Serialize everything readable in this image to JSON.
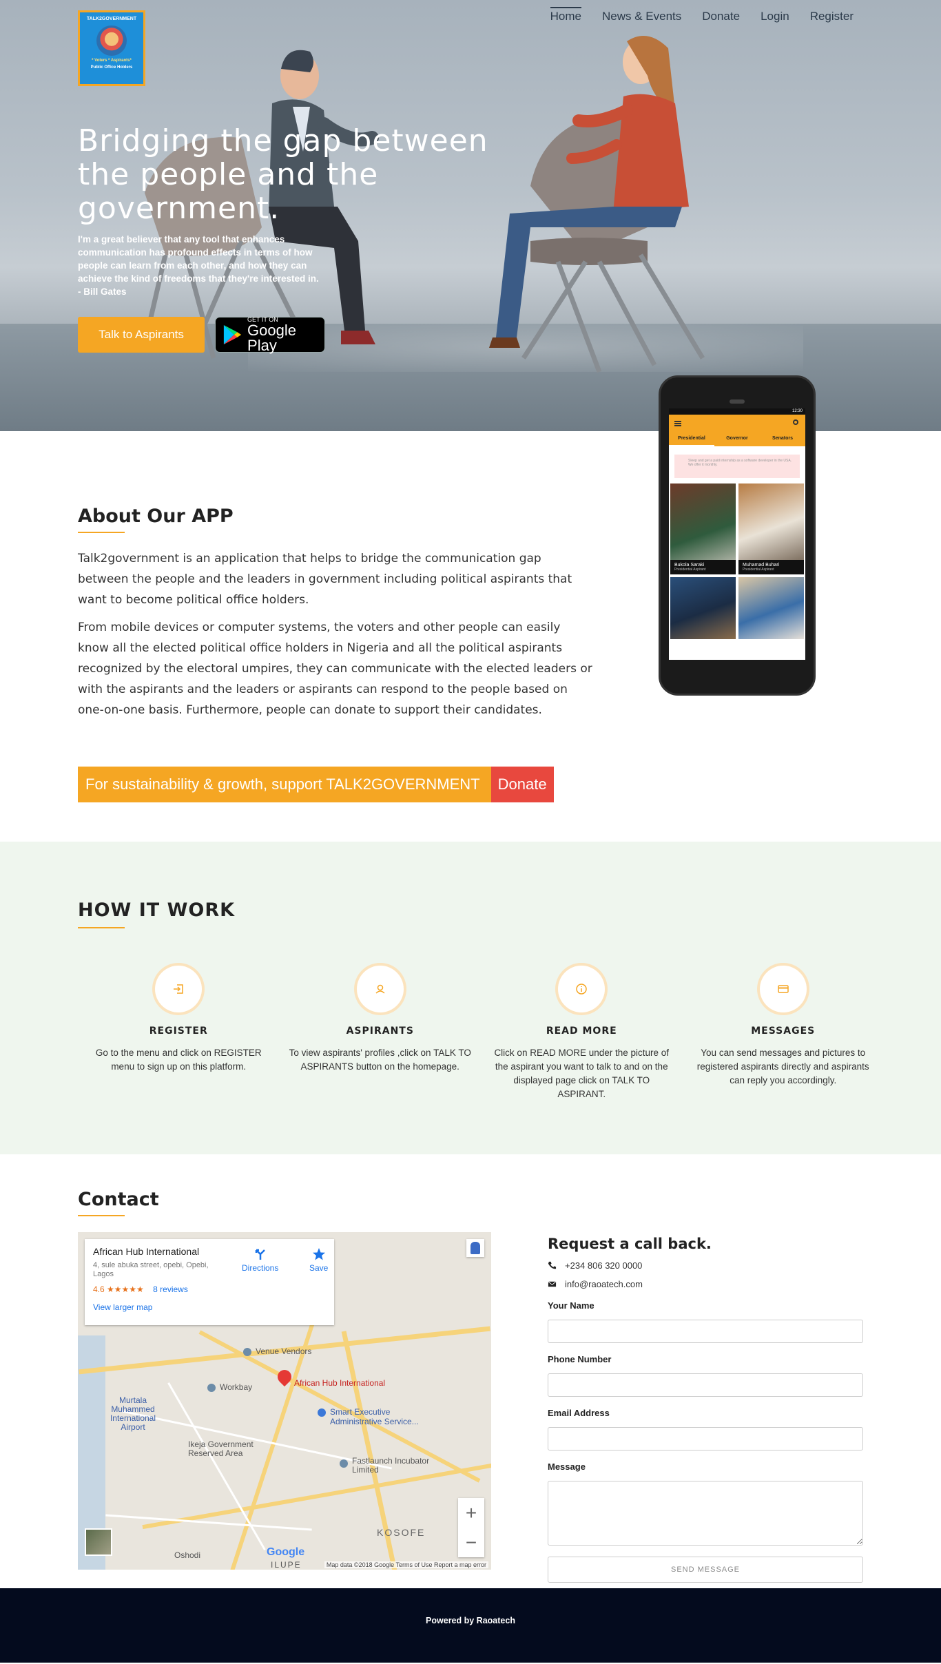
{
  "logo": {
    "top": "TALK2GOVERNMENT",
    "mid": "* Voters * Aspirants*",
    "bottom": "Public Office Holders"
  },
  "nav": [
    {
      "label": "Home",
      "active": true
    },
    {
      "label": "News & Events"
    },
    {
      "label": "Donate"
    },
    {
      "label": "Login"
    },
    {
      "label": "Register"
    }
  ],
  "hero": {
    "title": "Bridging the gap between the people and the government.",
    "quote": "I'm a great believer that any tool that enhances communication has profound effects in terms of how people can learn from each other, and how they can achieve the kind of freedoms that they're interested in.",
    "quote_author": "- Bill Gates",
    "talk_button": "Talk to Aspirants",
    "gplay_small": "GET IT ON",
    "gplay_big": "Google Play"
  },
  "phone": {
    "status_time": "12:30",
    "tabs": [
      "Presidential",
      "Governor",
      "Senators"
    ],
    "ad_text": "Sleep and get a paid internship as a software developer in the USA. We offer it monthly.",
    "cards": [
      {
        "name": "Bukola Saraki",
        "role": "Presidential Aspirant"
      },
      {
        "name": "Muhamad Buhari",
        "role": "Presidential Aspirant"
      }
    ]
  },
  "about": {
    "heading": "About Our APP",
    "p1": "Talk2government is an application that helps to bridge the communication gap between the people and the leaders in government including political aspirants that want to become political office holders.",
    "p2": "From mobile devices or computer systems, the voters and other people can easily know all the elected political office holders in Nigeria and all the political aspirants recognized by the electoral umpires, they can communicate with the elected leaders or with the aspirants and the leaders or aspirants can respond to the people based on one-on-one basis. Furthermore, people can donate to support their candidates.",
    "support_text": "For sustainability & growth, support TALK2GOVERNMENT",
    "donate_button": "Donate"
  },
  "how": {
    "heading": "HOW IT WORK",
    "steps": [
      {
        "icon": "sign-in-icon",
        "title": "REGISTER",
        "text": "Go to the menu and click on REGISTER menu to sign up on this platform."
      },
      {
        "icon": "user-icon",
        "title": "ASPIRANTS",
        "text": "To view aspirants' profiles ,click on TALK TO ASPIRANTS button on the homepage."
      },
      {
        "icon": "info-icon",
        "title": "READ MORE",
        "text": "Click on READ MORE under the picture of the aspirant you want to talk to and on the displayed page click on TALK TO ASPIRANT."
      },
      {
        "icon": "credit-card-icon",
        "title": "MESSAGES",
        "text": "You can send messages and pictures to registered aspirants directly and aspirants can reply you accordingly."
      }
    ]
  },
  "contact": {
    "heading": "Contact",
    "map": {
      "place_name": "African Hub International",
      "address": "4, sule abuka street, opebi, Opebi, Lagos",
      "rating": "4.6 ★★★★★",
      "reviews": "8 reviews",
      "view_larger": "View larger map",
      "directions": "Directions",
      "save": "Save",
      "labels": {
        "venue": "Venue Vendors",
        "workbay": "Workbay",
        "pin": "African Hub International",
        "smart": "Smart Executive Administrative Service...",
        "airport": "Murtala Muhammed International Airport",
        "ikeja": "Ikeja Government Reserved Area",
        "fastlaunch": "Fastlaunch Incubator Limited",
        "kosofe": "KOSOFE",
        "oshodi": "Oshodi",
        "ilupeju": "ILUPE"
      },
      "zoom_in": "+",
      "zoom_out": "−",
      "footnote": "Map data ©2018 Google   Terms of Use   Report a map error",
      "google": "Google"
    },
    "form": {
      "title": "Request a call back.",
      "phone": "+234 806 320 0000",
      "email": "info@raoatech.com",
      "name_label": "Your Name",
      "phone_label": "Phone Number",
      "email_label": "Email Address",
      "message_label": "Message",
      "name_value": "",
      "phone_value": "",
      "email_value": "",
      "message_value": "",
      "send_button": "SEND MESSAGE"
    }
  },
  "footer": {
    "text": "Powered by Raoatech"
  },
  "colors": {
    "accent": "#f5a623",
    "donate": "#e8483e",
    "how_bg": "#eff6ee",
    "footer_bg": "#040b1e"
  }
}
